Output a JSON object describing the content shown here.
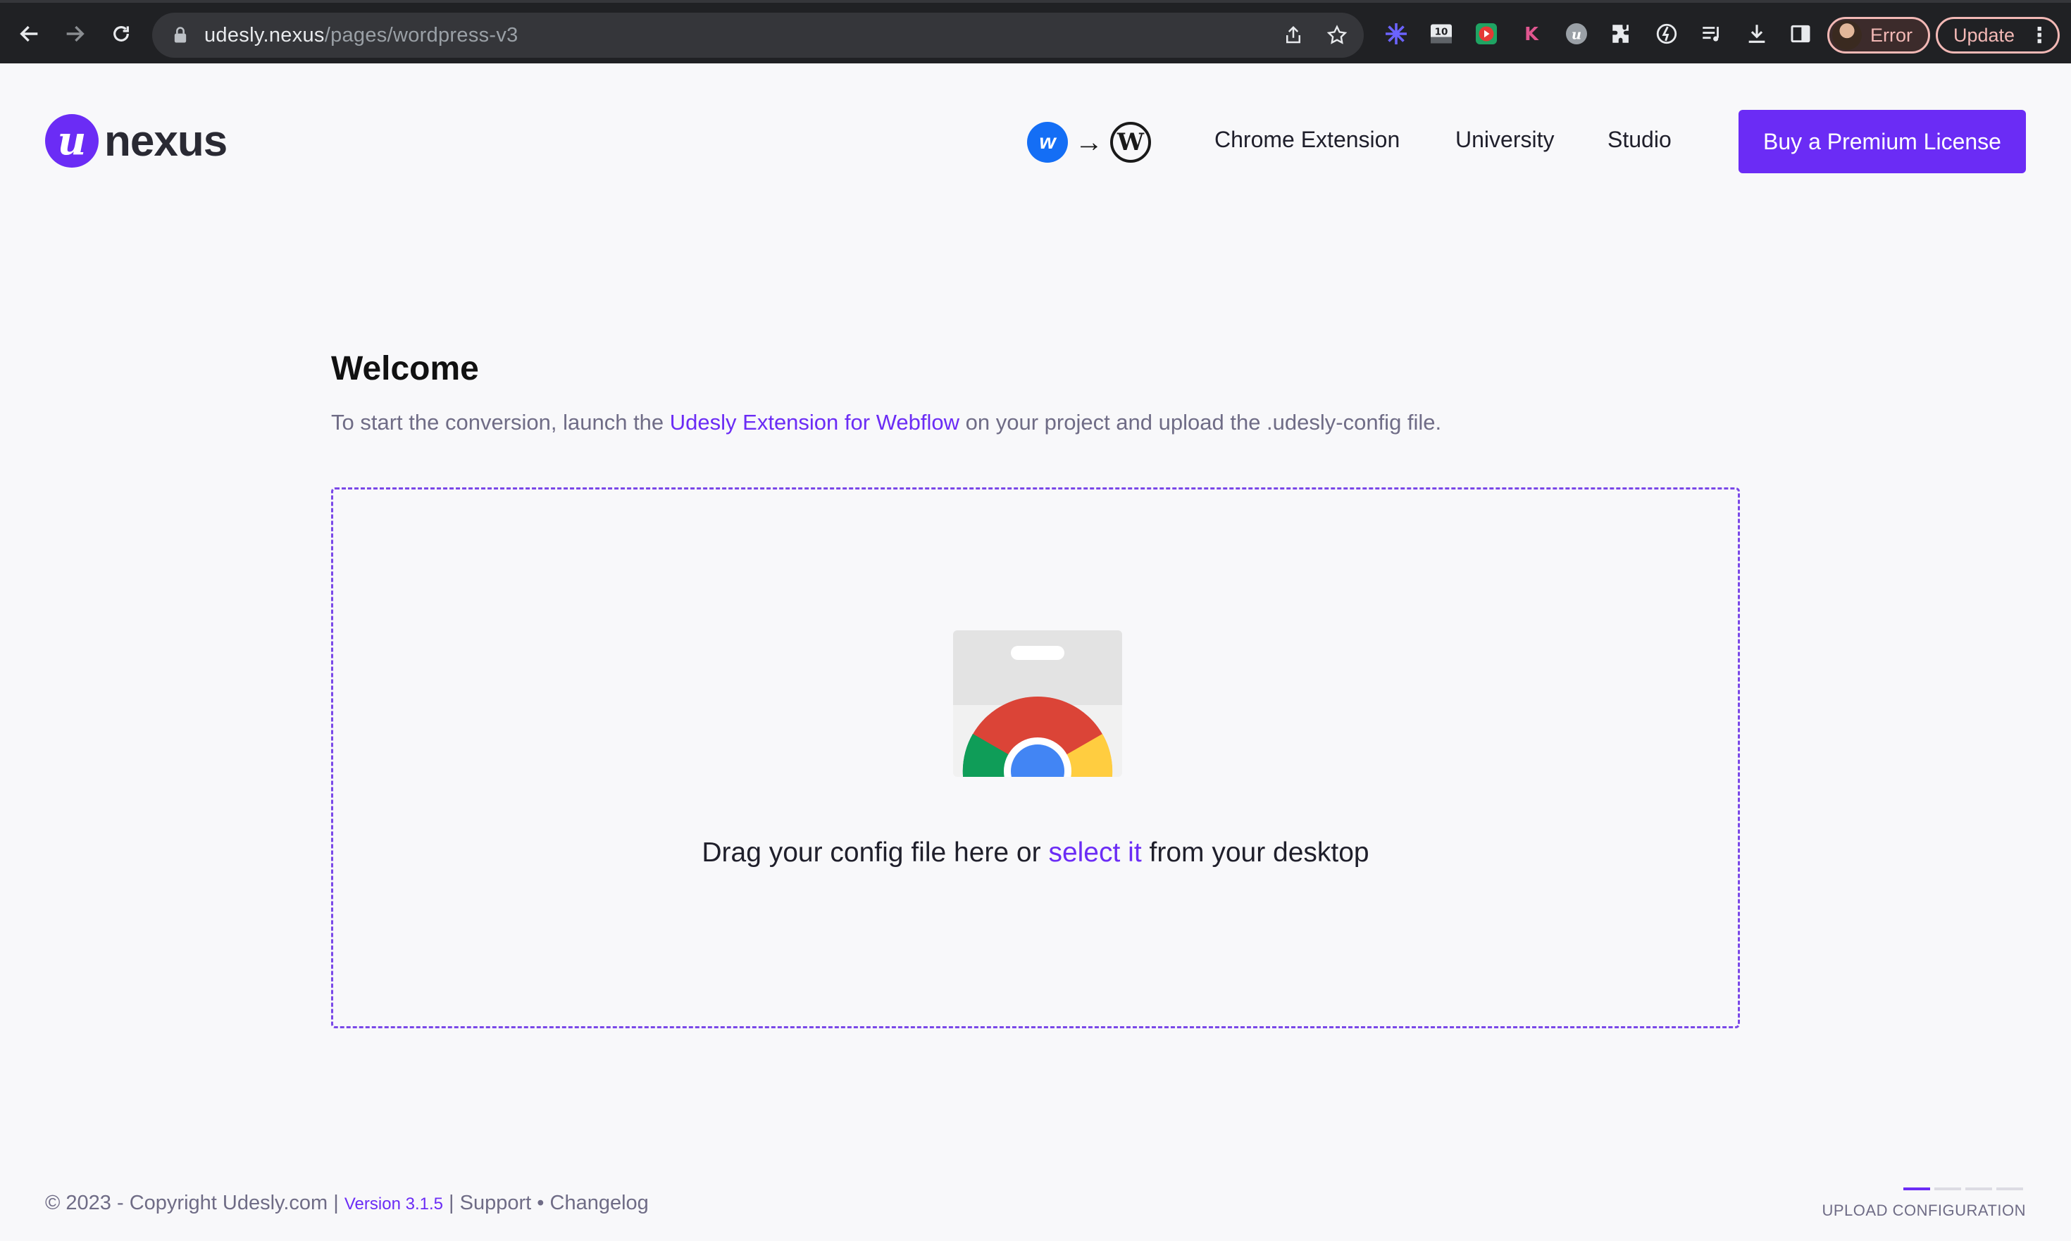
{
  "browser": {
    "url_host": "udesly.nexus",
    "url_path": "/pages/wordpress-v3",
    "error_label": "Error",
    "update_label": "Update",
    "extensions": [
      "snowflake-extension-icon",
      "ten-extension-icon",
      "play-extension-icon",
      "k-extension-icon",
      "udesly-extension-icon",
      "puzzle-extension-icon"
    ]
  },
  "header": {
    "logo_mark": "u",
    "logo_text": "nexus",
    "webflow_mark": "w",
    "wordpress_mark": "W",
    "nav": [
      "Chrome Extension",
      "University",
      "Studio"
    ],
    "cta_label": "Buy a Premium License"
  },
  "main": {
    "title": "Welcome",
    "intro_before": "To start the conversion, launch the ",
    "intro_link": "Udesly Extension for Webflow",
    "intro_after": " on your project and upload the .udesly-config file.",
    "drop_before": "Drag your config file here or ",
    "drop_link": "select it",
    "drop_after": " from your desktop"
  },
  "footer": {
    "copyright": "© 2023 - Copyright Udesly.com",
    "sep1": " | ",
    "version": "Version 3.1.5",
    "sep2": " | ",
    "support": "Support",
    "dot": " • ",
    "changelog": "Changelog",
    "step_label": "UPLOAD CONFIGURATION",
    "steps_total": 4,
    "steps_current": 1
  },
  "colors": {
    "brand": "#6b2cf5",
    "background": "#f8f8fa",
    "text_muted": "#6f6c86"
  }
}
